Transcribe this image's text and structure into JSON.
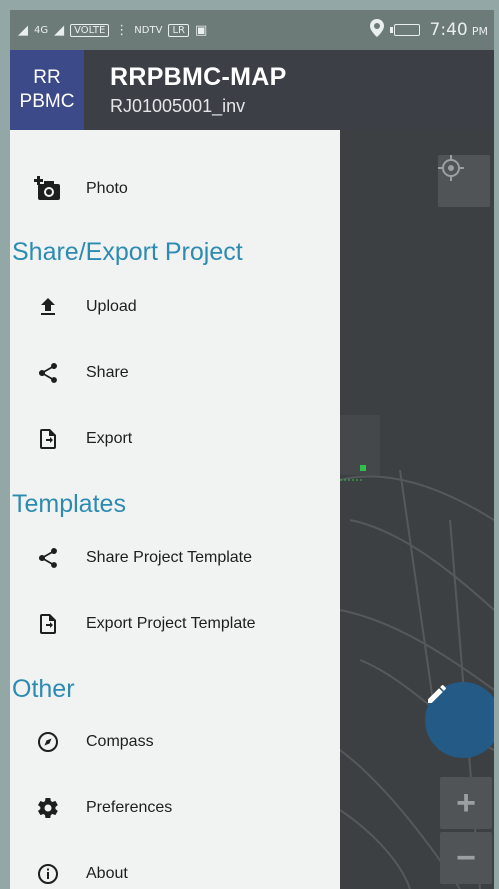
{
  "status_bar": {
    "left_text_1": "R",
    "left_text_2": "4G",
    "left_text_3": "R",
    "volte": "VOLTE",
    "dots": "⋮",
    "ndtv": "NDTV",
    "lr": "LR",
    "time": "7:40",
    "ampm": "PM"
  },
  "header": {
    "logo_line1": "RR",
    "logo_line2": "PBMC",
    "title": "RRPBMC-MAP",
    "subtitle": "RJ01005001_inv"
  },
  "drawer": {
    "photo_label": "Photo",
    "section_share": "Share/Export Project",
    "upload_label": "Upload",
    "share_label": "Share",
    "export_label": "Export",
    "section_templates": "Templates",
    "share_template_label": "Share Project Template",
    "export_template_label": "Export Project Template",
    "section_other": "Other",
    "compass_label": "Compass",
    "preferences_label": "Preferences",
    "about_label": "About"
  },
  "map": {
    "zoom_in": "+",
    "zoom_out": "−"
  },
  "colors": {
    "header_bg": "#3c3f45",
    "logo_bg": "#3c4a8a",
    "section_text": "#2d8bb1",
    "fab_bg": "#245a86"
  }
}
